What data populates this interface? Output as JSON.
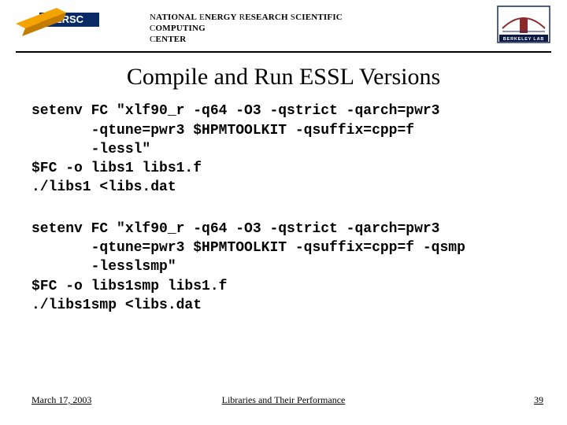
{
  "header": {
    "logo_text": "ERSC",
    "org_html": "N<b>ATIONAL</b> E<b>NERGY</b> R<b>ESEARCH</b> S<b>CIENTIFIC</b> C<b>OMPUTING</b> C<b>ENTER</b>",
    "lab_label": "BERKELEY LAB"
  },
  "title": "Compile and Run ESSL Versions",
  "code1": "setenv FC \"xlf90_r -q64 -O3 -qstrict -qarch=pwr3\n       -qtune=pwr3 $HPMTOOLKIT -qsuffix=cpp=f\n       -lessl\"\n$FC -o libs1 libs1.f\n./libs1 <libs.dat",
  "code2": "setenv FC \"xlf90_r -q64 -O3 -qstrict -qarch=pwr3\n       -qtune=pwr3 $HPMTOOLKIT -qsuffix=cpp=f -qsmp\n       -lesslsmp\"\n$FC -o libs1smp libs1.f\n./libs1smp <libs.dat",
  "footer": {
    "date": "March 17, 2003",
    "center": "Libraries and Their Performance",
    "page": "39"
  }
}
